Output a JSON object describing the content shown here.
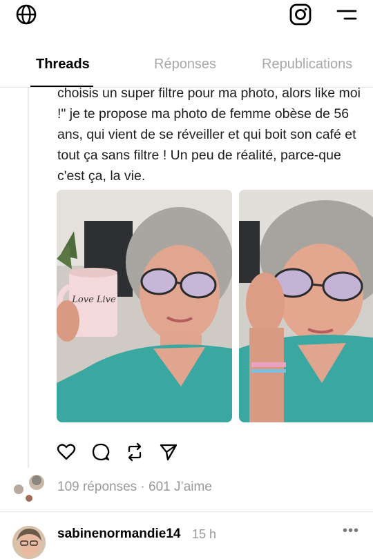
{
  "tabs": {
    "active": "Threads",
    "second": "Réponses",
    "third": "Republications"
  },
  "post": {
    "text": "choisis un super filtre pour ma photo, alors like moi !\" je te propose ma photo de femme obèse de 56 ans, qui vient de se réveiller et qui boit son café et tout ça sans filtre ! Un peu de réalité, parce-que c'est ça, la vie.",
    "mug_text": "Love Live"
  },
  "stats": {
    "text": "109 réponses · 601 J’aime"
  },
  "reply": {
    "username": "sabinenormandie14",
    "time": "15 h",
    "more": "•••"
  },
  "icons": [
    "globe-icon",
    "instagram-icon",
    "menu-icon",
    "heart-icon",
    "reply-icon",
    "repost-icon",
    "share-icon",
    "more-icon"
  ],
  "colors": {
    "inactive_tab": "#a8a8a8",
    "stats": "#999999",
    "dress": "#3aa7a0"
  }
}
